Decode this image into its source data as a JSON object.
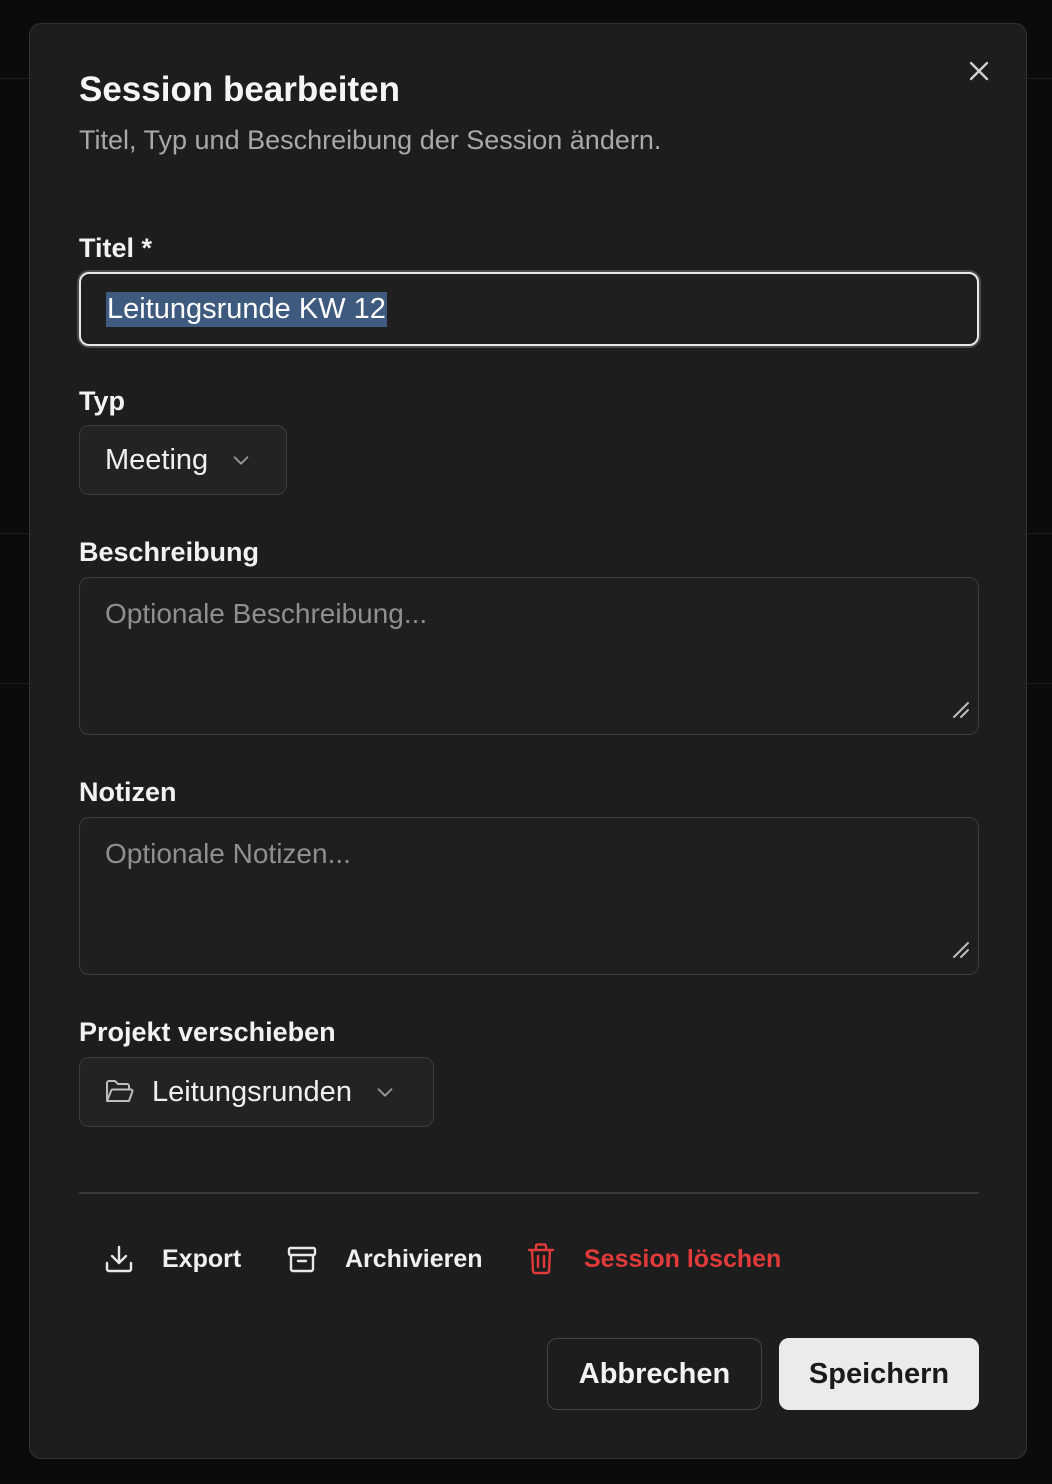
{
  "dialog": {
    "title": "Session bearbeiten",
    "subtitle": "Titel, Typ und Beschreibung der Session ändern.",
    "close_icon": "close-icon"
  },
  "form": {
    "title_label": "Titel *",
    "title_value": "Leitungsrunde KW 12",
    "type_label": "Typ",
    "type_value": "Meeting",
    "description_label": "Beschreibung",
    "description_placeholder": "Optionale Beschreibung...",
    "notes_label": "Notizen",
    "notes_placeholder": "Optionale Notizen...",
    "project_label": "Projekt verschieben",
    "project_value": "Leitungsrunden"
  },
  "actions": {
    "export": "Export",
    "archive": "Archivieren",
    "delete": "Session löschen"
  },
  "footer": {
    "cancel": "Abbrechen",
    "save": "Speichern"
  },
  "colors": {
    "danger": "#e03a3a",
    "selection": "#3e5a7e",
    "primary_button": "#ebebea"
  }
}
